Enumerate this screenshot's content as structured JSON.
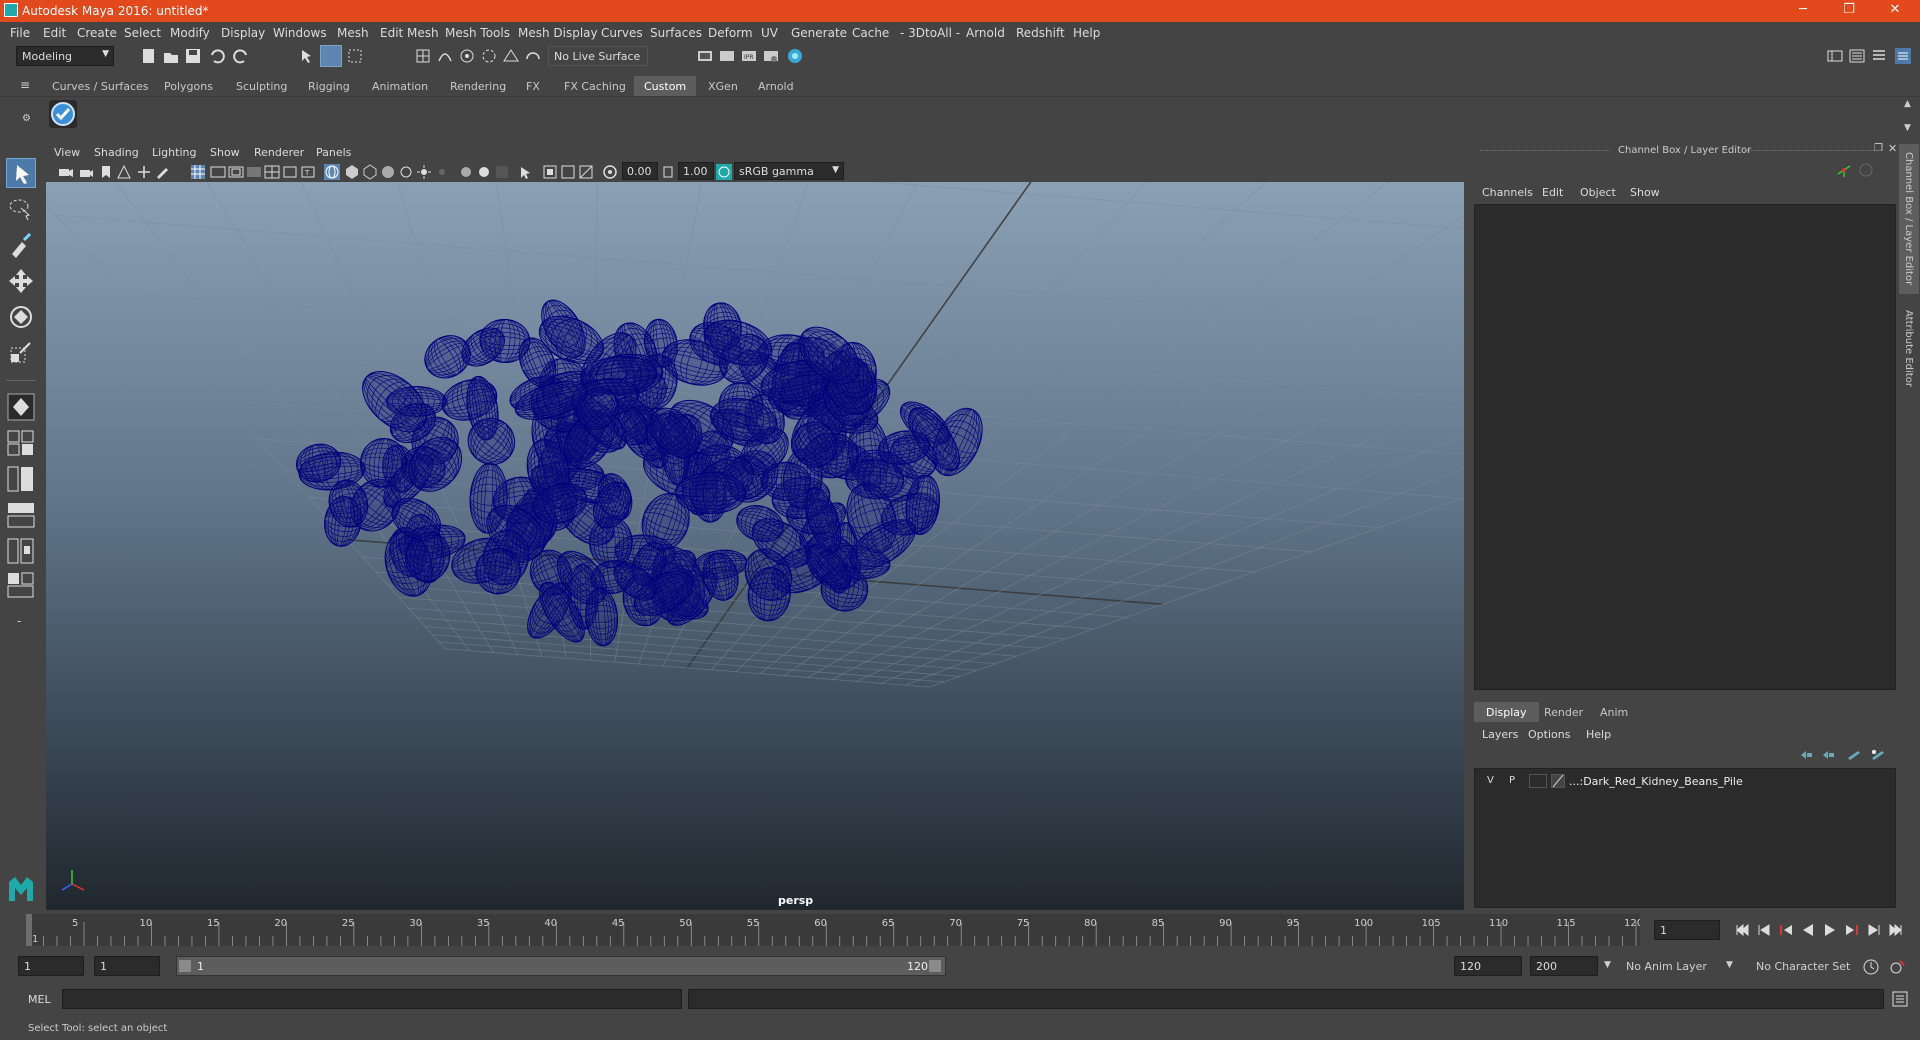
{
  "window": {
    "title": "Autodesk Maya 2016: untitled*",
    "minimize": "─",
    "restore": "❐",
    "close": "✕"
  },
  "menubar": [
    "File",
    "Edit",
    "Create",
    "Select",
    "Modify",
    "Display",
    "Windows",
    "Mesh",
    "Edit Mesh",
    "Mesh Tools",
    "Mesh Display",
    "Curves",
    "Surfaces",
    "Deform",
    "UV",
    "Generate",
    "Cache",
    "- 3DtoAll -",
    "Arnold",
    "Redshift",
    "Help"
  ],
  "status": {
    "menuset": "Modeling",
    "live_surface": "No Live Surface"
  },
  "shelf": {
    "tabs": [
      "Curves / Surfaces",
      "Polygons",
      "Sculpting",
      "Rigging",
      "Animation",
      "Rendering",
      "FX",
      "FX Caching",
      "Custom",
      "XGen",
      "Arnold"
    ],
    "active": "Custom"
  },
  "panel": {
    "menu": [
      "View",
      "Shading",
      "Lighting",
      "Show",
      "Renderer",
      "Panels"
    ],
    "exposure": "0.00",
    "gamma": "1.00",
    "colorspace": "sRGB gamma",
    "camera": "persp"
  },
  "channelbox": {
    "header": "Channel Box / Layer Editor",
    "menu": [
      "Channels",
      "Edit",
      "Object",
      "Show"
    ]
  },
  "layers": {
    "tabs": [
      "Display",
      "Render",
      "Anim"
    ],
    "active": "Display",
    "menu": [
      "Layers",
      "Options",
      "Help"
    ],
    "rows": [
      {
        "v": "V",
        "p": "P",
        "name": "...:Dark_Red_Kidney_Beans_Pile"
      }
    ]
  },
  "sidetabs": [
    "Channel Box / Layer Editor",
    "Attribute Editor"
  ],
  "timeline": {
    "ticks": [
      "1",
      "5",
      "10",
      "15",
      "20",
      "25",
      "30",
      "35",
      "40",
      "45",
      "50",
      "55",
      "60",
      "65",
      "70",
      "75",
      "80",
      "85",
      "90",
      "95",
      "100",
      "105",
      "110",
      "115",
      "120"
    ],
    "current_frame": "1"
  },
  "range": {
    "start": "1",
    "playback_start": "1",
    "slider_start": "1",
    "slider_end": "120",
    "playback_end": "120",
    "end": "200",
    "anim_layer": "No Anim Layer",
    "character_set": "No Character Set"
  },
  "command": {
    "label": "MEL"
  },
  "help": {
    "text": "Select Tool: select an object"
  },
  "colors": {
    "title_bar": "#e2491c",
    "wireframe": "#00007a",
    "active_tab": "#5d5d5d",
    "select_tool": "#4d7aa8"
  }
}
